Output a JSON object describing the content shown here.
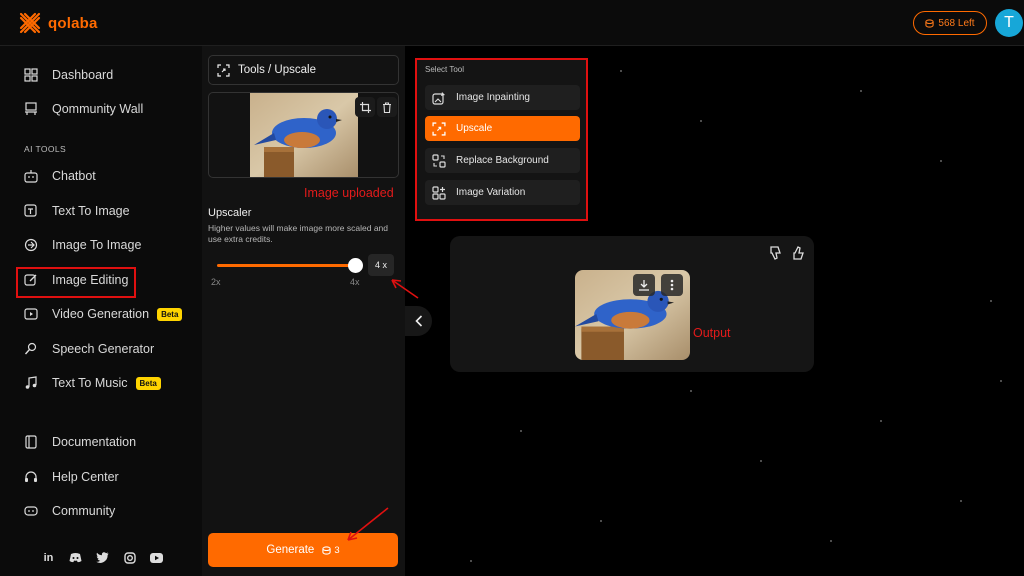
{
  "brand": {
    "name": "qolaba",
    "accent": "#ff6a00"
  },
  "header": {
    "credits_label": "568 Left",
    "avatar_initial": "T"
  },
  "sidebar": {
    "top_items": [
      {
        "label": "Dashboard",
        "icon": "dashboard-icon"
      },
      {
        "label": "Qommunity Wall",
        "icon": "community-wall-icon"
      }
    ],
    "section_label": "AI TOOLS",
    "tool_items": [
      {
        "label": "Chatbot",
        "icon": "chatbot-icon"
      },
      {
        "label": "Text To Image",
        "icon": "text-to-image-icon"
      },
      {
        "label": "Image To Image",
        "icon": "image-to-image-icon"
      },
      {
        "label": "Image Editing",
        "icon": "image-editing-icon"
      },
      {
        "label": "Video Generation",
        "icon": "video-icon",
        "badge": "Beta"
      },
      {
        "label": "Speech Generator",
        "icon": "speech-icon"
      },
      {
        "label": "Text To Music",
        "icon": "music-icon",
        "badge": "Beta"
      }
    ],
    "bottom_items": [
      {
        "label": "Documentation",
        "icon": "documentation-icon"
      },
      {
        "label": "Help Center",
        "icon": "headset-icon"
      },
      {
        "label": "Community",
        "icon": "community-icon"
      }
    ],
    "socials": [
      "linkedin-icon",
      "discord-icon",
      "twitter-icon",
      "instagram-icon",
      "youtube-icon"
    ]
  },
  "panel": {
    "breadcrumb": "Tools / Upscale",
    "upscaler_title": "Upscaler",
    "upscaler_desc": "Higher values will make image more scaled and use extra credits.",
    "slider": {
      "value_label": "4 x",
      "min_label": "2x",
      "max_label": "4x",
      "level": 1.0
    },
    "generate_label": "Generate",
    "generate_cost": "3"
  },
  "tool_menu": {
    "label": "Select Tool",
    "items": [
      {
        "label": "Image Inpainting",
        "active": false
      },
      {
        "label": "Upscale",
        "active": true
      },
      {
        "label": "Replace Background",
        "active": false
      },
      {
        "label": "Image Variation",
        "active": false
      }
    ]
  },
  "annotations": {
    "uploaded": "Image uploaded",
    "output": "Output"
  }
}
